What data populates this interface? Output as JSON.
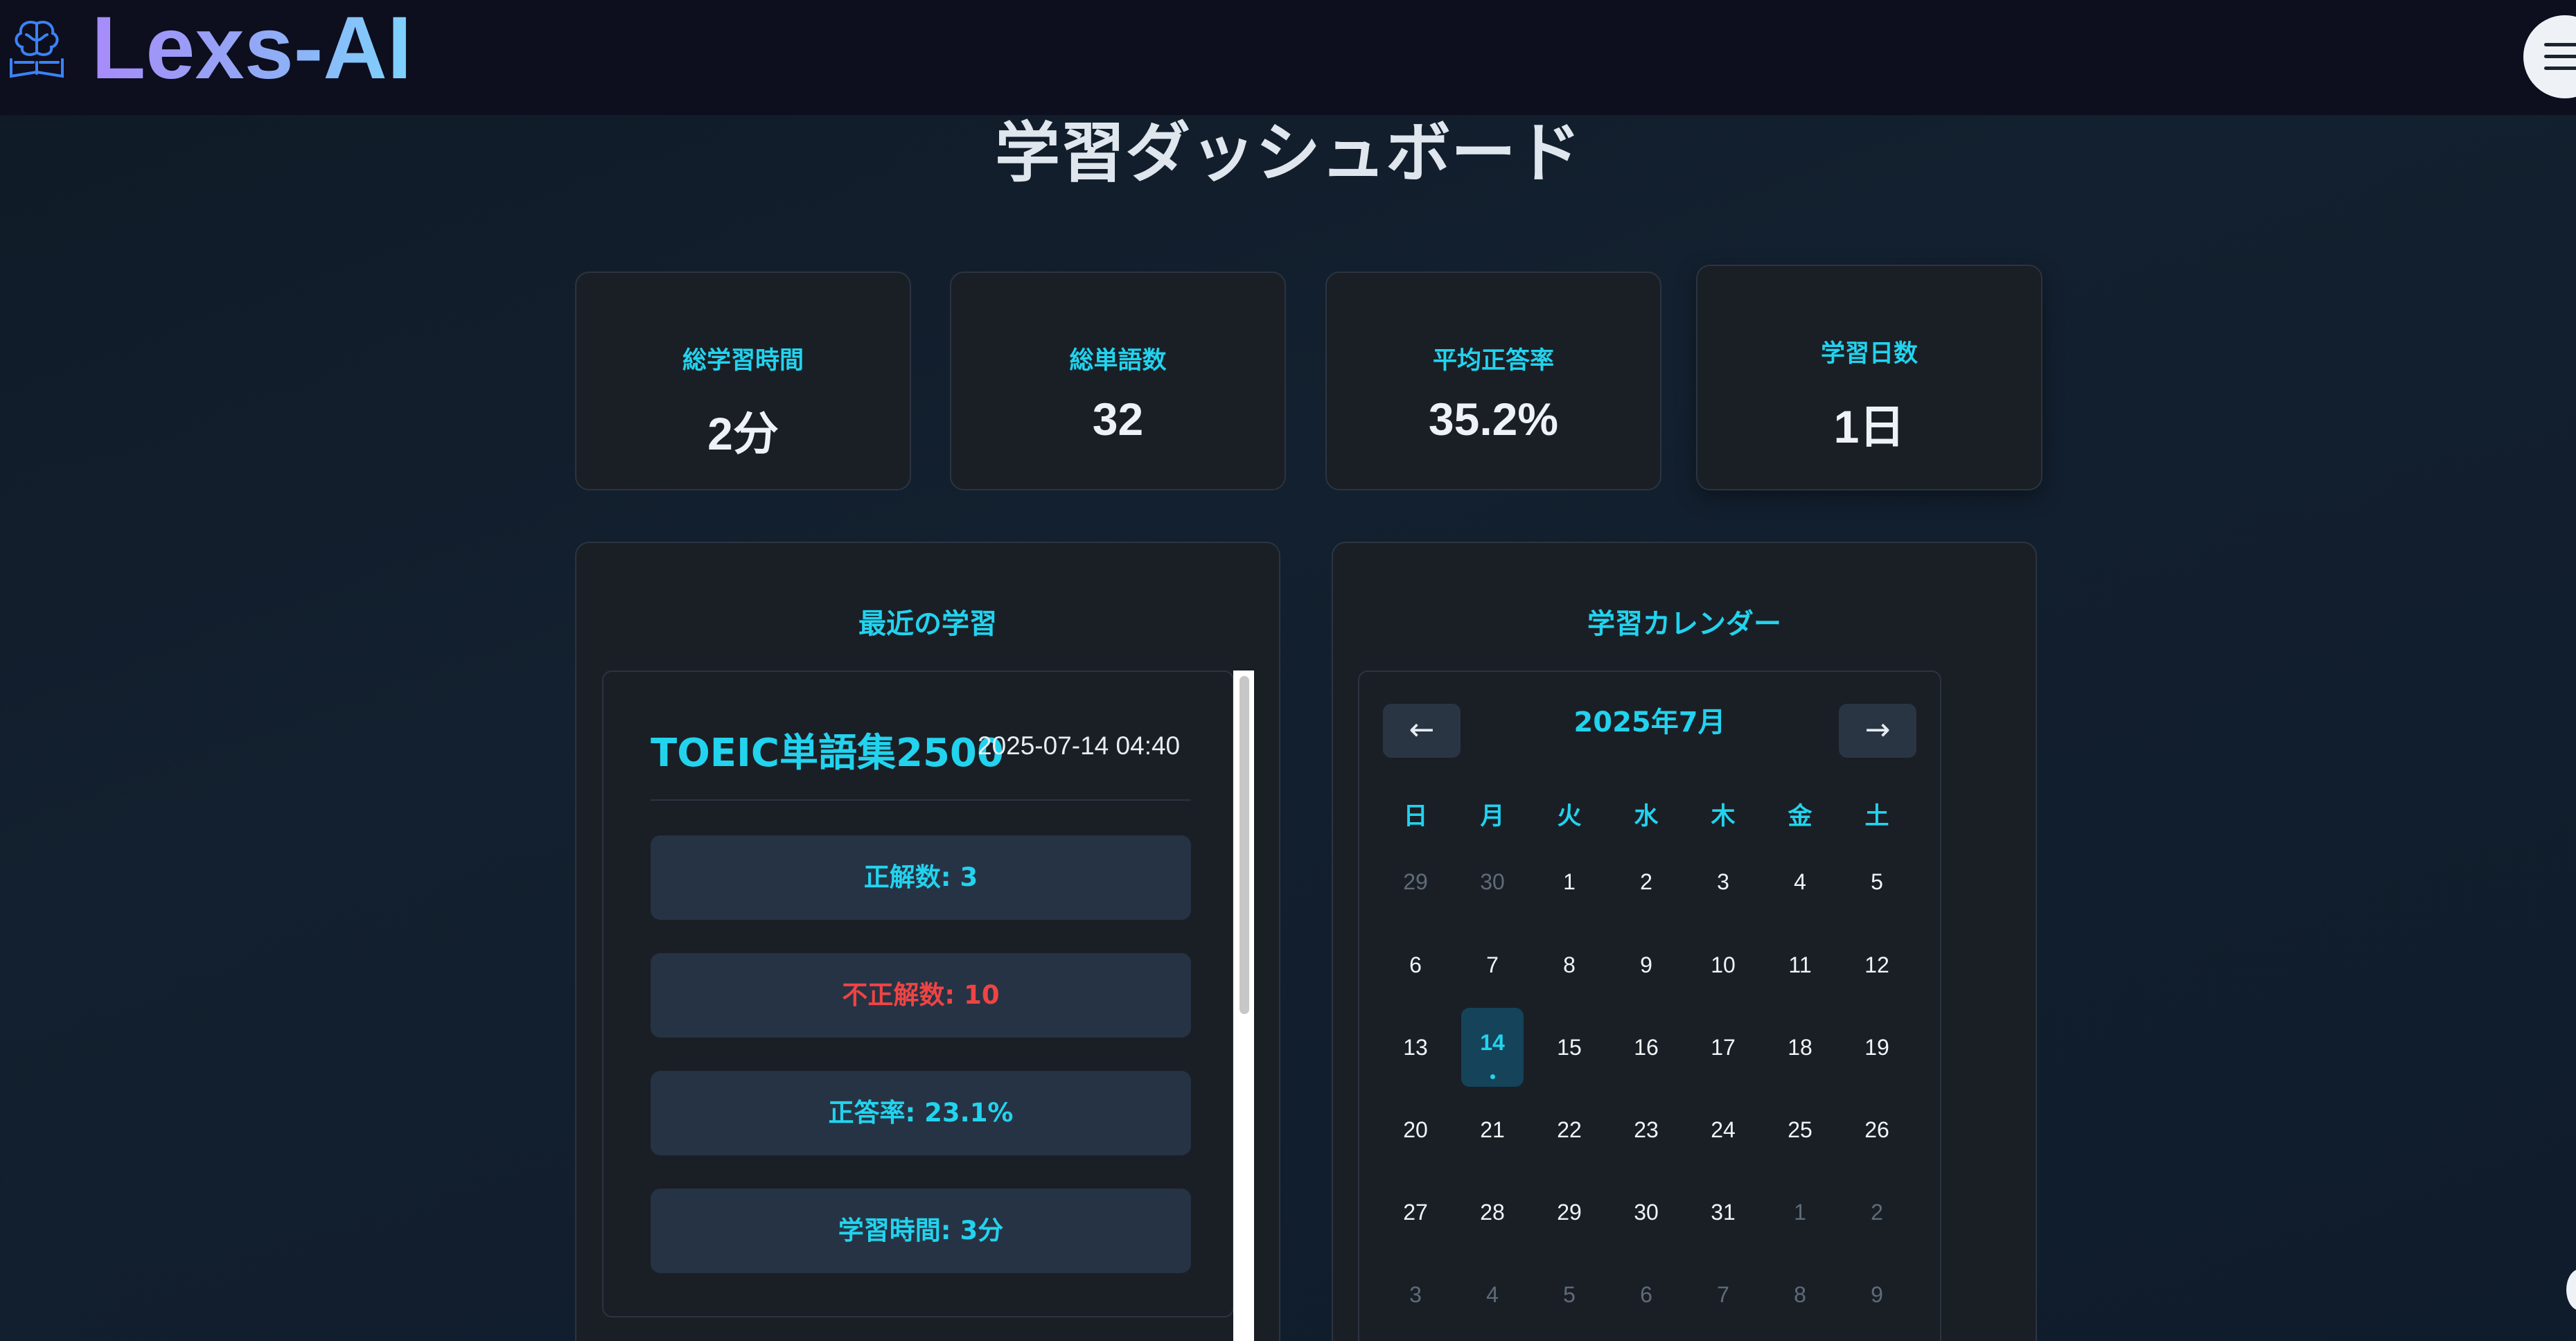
{
  "header": {
    "brand": "Lexs-AI",
    "brand_icon": "brain-book-icon",
    "menu_icon": "hamburger-menu-icon"
  },
  "page": {
    "title": "学習ダッシュボード"
  },
  "stats": [
    {
      "label": "総学習時間",
      "value": "2分"
    },
    {
      "label": "総単語数",
      "value": "32"
    },
    {
      "label": "平均正答率",
      "value": "35.2%"
    },
    {
      "label": "学習日数",
      "value": "1日"
    }
  ],
  "recent": {
    "title": "最近の学習",
    "item": {
      "name": "TOEIC単語集2500",
      "date": "2025-07-14 04:40",
      "correct": "正解数: 3",
      "incorrect": "不正解数: 10",
      "accuracy": "正答率: 23.1%",
      "time": "学習時間: 3分"
    }
  },
  "calendar": {
    "title": "学習カレンダー",
    "month_label": "2025年7月",
    "prev": "←",
    "next": "→",
    "weekdays": [
      "日",
      "月",
      "火",
      "水",
      "木",
      "金",
      "土"
    ],
    "weeks": [
      [
        "29",
        "30",
        "1",
        "2",
        "3",
        "4",
        "5"
      ],
      [
        "6",
        "7",
        "8",
        "9",
        "10",
        "11",
        "12"
      ],
      [
        "13",
        "14",
        "15",
        "16",
        "17",
        "18",
        "19"
      ],
      [
        "20",
        "21",
        "22",
        "23",
        "24",
        "25",
        "26"
      ],
      [
        "27",
        "28",
        "29",
        "30",
        "31",
        "1",
        "2"
      ],
      [
        "3",
        "4",
        "5",
        "6",
        "7",
        "8",
        "9"
      ]
    ],
    "muted": [
      [
        true,
        true,
        false,
        false,
        false,
        false,
        false
      ],
      [
        false,
        false,
        false,
        false,
        false,
        false,
        false
      ],
      [
        false,
        false,
        false,
        false,
        false,
        false,
        false
      ],
      [
        false,
        false,
        false,
        false,
        false,
        false,
        false
      ],
      [
        false,
        false,
        false,
        false,
        false,
        true,
        true
      ],
      [
        true,
        true,
        true,
        true,
        true,
        true,
        true
      ]
    ],
    "today": "14"
  },
  "colors": {
    "accent": "#22d3ee",
    "error": "#ef4444",
    "background": "#13202f",
    "card": "#1a1f26"
  }
}
